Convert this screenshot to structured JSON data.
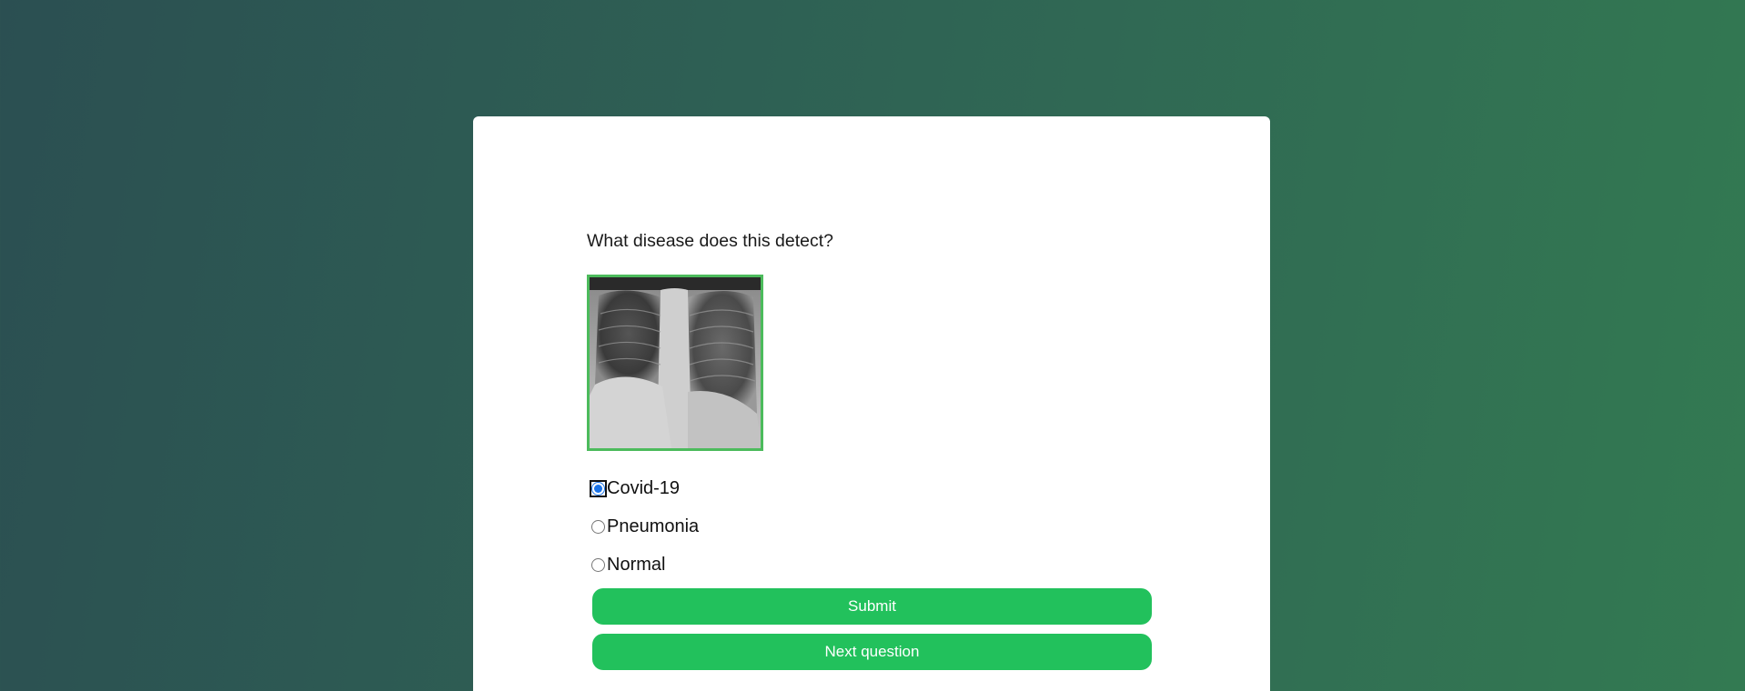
{
  "quiz": {
    "question": "What disease does this detect?",
    "image_icon": "chest-xray-image",
    "options": [
      {
        "label": "Covid-19",
        "selected": true
      },
      {
        "label": "Pneumonia",
        "selected": false
      },
      {
        "label": "Normal",
        "selected": false
      }
    ],
    "submit_label": "Submit",
    "next_label": "Next question"
  },
  "colors": {
    "background_start": "#2b4f52",
    "background_end": "#337a52",
    "card": "#ffffff",
    "button": "#22c15c",
    "image_border": "#4cbb5c",
    "radio_accent": "#1a73e8"
  }
}
